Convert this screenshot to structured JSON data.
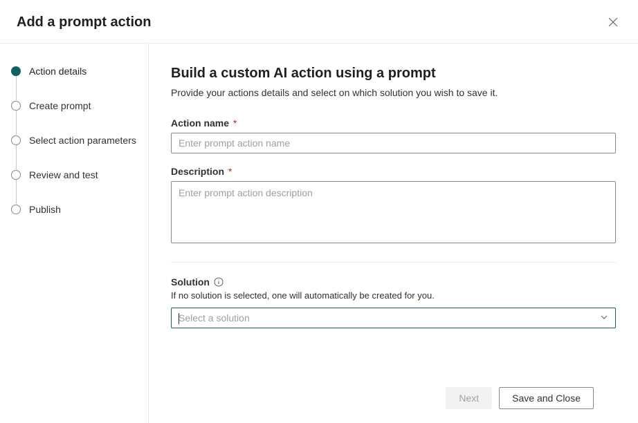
{
  "header": {
    "title": "Add a prompt action"
  },
  "sidebar": {
    "steps": [
      {
        "label": "Action details",
        "active": true
      },
      {
        "label": "Create prompt",
        "active": false
      },
      {
        "label": "Select action parameters",
        "active": false
      },
      {
        "label": "Review and test",
        "active": false
      },
      {
        "label": "Publish",
        "active": false
      }
    ]
  },
  "main": {
    "heading": "Build a custom AI action using a prompt",
    "lead": "Provide your actions details and select on which solution you wish to save it.",
    "actionName": {
      "label": "Action name",
      "required": "*",
      "placeholder": "Enter prompt action name",
      "value": ""
    },
    "description": {
      "label": "Description",
      "required": "*",
      "placeholder": "Enter prompt action description",
      "value": ""
    },
    "solution": {
      "label": "Solution",
      "helper": "If no solution is selected, one will automatically be created for you.",
      "placeholder": "Select a solution",
      "selectedValue": ""
    }
  },
  "footer": {
    "nextLabel": "Next",
    "saveLabel": "Save and Close"
  }
}
